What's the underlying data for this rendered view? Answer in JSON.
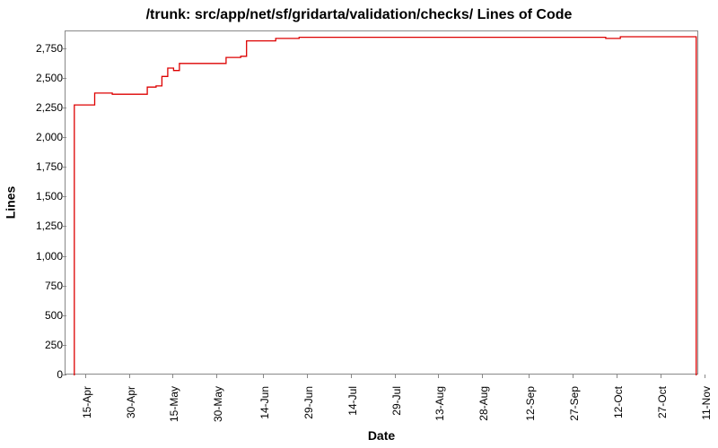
{
  "chart_data": {
    "type": "line",
    "title": "/trunk: src/app/net/sf/gridarta/validation/checks/ Lines of Code",
    "xlabel": "Date",
    "ylabel": "Lines",
    "ylim": [
      0,
      2900
    ],
    "xlim_days": [
      0,
      217
    ],
    "y_ticks": [
      0,
      250,
      500,
      750,
      1000,
      1250,
      1500,
      1750,
      2000,
      2250,
      2500,
      2750
    ],
    "y_tick_labels": [
      "0",
      "250",
      "500",
      "750",
      "1,000",
      "1,250",
      "1,500",
      "1,750",
      "2,000",
      "2,250",
      "2,500",
      "2,750"
    ],
    "x_ticks_days": [
      7,
      22,
      37,
      52,
      68,
      83,
      98,
      113,
      128,
      143,
      159,
      174,
      189,
      204,
      219
    ],
    "x_tick_labels": [
      "15-Apr",
      "30-Apr",
      "15-May",
      "30-May",
      "14-Jun",
      "29-Jun",
      "14-Jul",
      "29-Jul",
      "13-Aug",
      "28-Aug",
      "12-Sep",
      "27-Sep",
      "12-Oct",
      "27-Oct",
      "11-Nov"
    ],
    "series": [
      {
        "name": "Lines of Code",
        "color": "#dd0000",
        "points": [
          {
            "x_day": 3,
            "y": 0
          },
          {
            "x_day": 3,
            "y": 2280
          },
          {
            "x_day": 10,
            "y": 2280
          },
          {
            "x_day": 10,
            "y": 2380
          },
          {
            "x_day": 16,
            "y": 2380
          },
          {
            "x_day": 16,
            "y": 2370
          },
          {
            "x_day": 28,
            "y": 2370
          },
          {
            "x_day": 28,
            "y": 2430
          },
          {
            "x_day": 31,
            "y": 2430
          },
          {
            "x_day": 31,
            "y": 2440
          },
          {
            "x_day": 33,
            "y": 2440
          },
          {
            "x_day": 33,
            "y": 2520
          },
          {
            "x_day": 35,
            "y": 2520
          },
          {
            "x_day": 35,
            "y": 2590
          },
          {
            "x_day": 37,
            "y": 2590
          },
          {
            "x_day": 37,
            "y": 2570
          },
          {
            "x_day": 39,
            "y": 2570
          },
          {
            "x_day": 39,
            "y": 2630
          },
          {
            "x_day": 55,
            "y": 2630
          },
          {
            "x_day": 55,
            "y": 2680
          },
          {
            "x_day": 60,
            "y": 2680
          },
          {
            "x_day": 60,
            "y": 2690
          },
          {
            "x_day": 62,
            "y": 2690
          },
          {
            "x_day": 62,
            "y": 2820
          },
          {
            "x_day": 72,
            "y": 2820
          },
          {
            "x_day": 72,
            "y": 2840
          },
          {
            "x_day": 80,
            "y": 2840
          },
          {
            "x_day": 80,
            "y": 2850
          },
          {
            "x_day": 185,
            "y": 2850
          },
          {
            "x_day": 185,
            "y": 2840
          },
          {
            "x_day": 190,
            "y": 2840
          },
          {
            "x_day": 190,
            "y": 2855
          },
          {
            "x_day": 216,
            "y": 2855
          },
          {
            "x_day": 216,
            "y": 0
          }
        ]
      }
    ]
  }
}
